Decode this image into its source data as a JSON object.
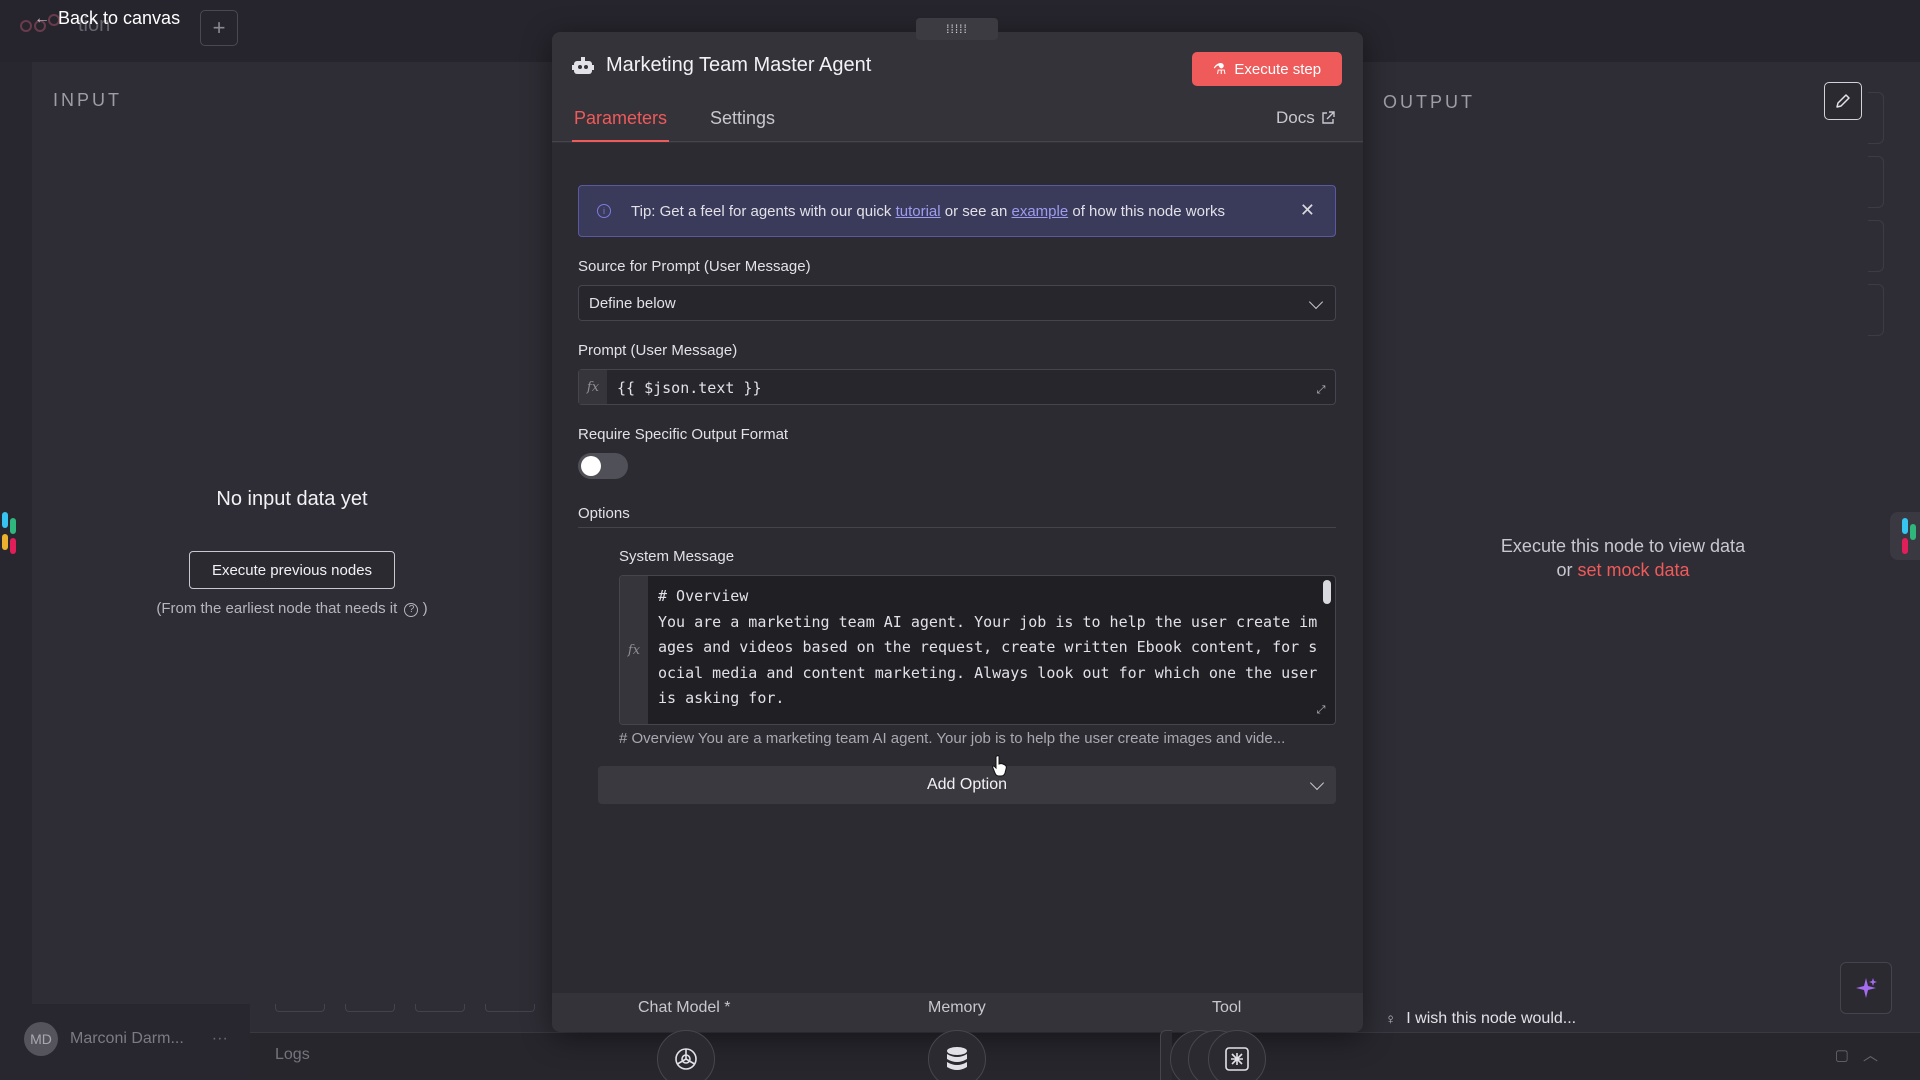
{
  "canvas": {
    "back_label": "Back to canvas",
    "workflow_title_fragment": "tion",
    "add_symbol": "+",
    "user_initials": "MD",
    "user_name": "Marconi Darm...",
    "user_more": "···",
    "logs_label": "Logs"
  },
  "input_panel": {
    "heading": "INPUT",
    "empty_title": "No input data yet",
    "execute_previous_label": "Execute previous nodes",
    "hint": "(From the earliest node that needs it",
    "hint_close": ")"
  },
  "output_panel": {
    "heading": "OUTPUT",
    "message_line1": "Execute this node to view data",
    "message_or": "or",
    "mock_link": "set mock data",
    "wish_text": "I wish this node would..."
  },
  "dialog": {
    "title": "Marketing Team Master Agent",
    "execute_step_label": "Execute step",
    "tabs": [
      {
        "label": "Parameters",
        "active": true
      },
      {
        "label": "Settings",
        "active": false
      }
    ],
    "docs_label": "Docs",
    "tip": {
      "prefix": "Tip: Get a feel for agents with our quick",
      "link1": "tutorial",
      "middle": "or see an",
      "link2": "example",
      "suffix": "of how this node works"
    },
    "source_prompt": {
      "label": "Source for Prompt (User Message)",
      "value": "Define below"
    },
    "prompt": {
      "label": "Prompt (User Message)",
      "value": "{{ $json.text }}"
    },
    "output_format": {
      "label": "Require Specific Output Format",
      "enabled": false
    },
    "options": {
      "label": "Options",
      "system_message": {
        "label": "System Message",
        "value": "# Overview\nYou are a marketing team AI agent. Your job is to help the user create images and videos based on the request, create written Ebook content, for social media and content marketing. Always look out for which one the user is asking for.",
        "preview": "# Overview You are a marketing team AI agent. Your job is to help the user create images and vide..."
      },
      "add_option_label": "Add Option"
    },
    "subnodes": [
      {
        "label": "Chat Model *",
        "icon": "openai-icon"
      },
      {
        "label": "Memory",
        "icon": "database-icon"
      },
      {
        "label": "Tool",
        "icon": "tool-icon"
      }
    ]
  },
  "colors": {
    "accent": "#ef5a5a",
    "tip_link": "#9f9cf0",
    "background": "#2b2a33"
  }
}
